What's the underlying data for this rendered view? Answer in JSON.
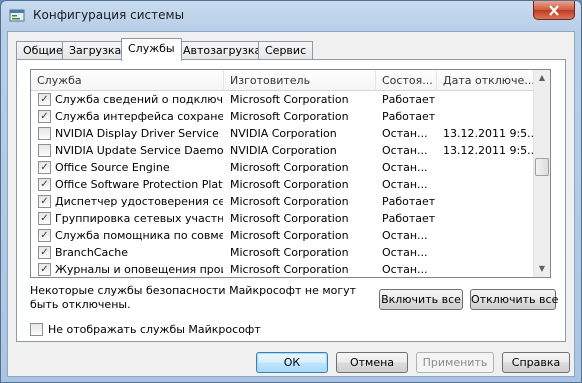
{
  "window": {
    "title": "Конфигурация системы"
  },
  "tabs": [
    "Общие",
    "Загрузка",
    "Службы",
    "Автозагрузка",
    "Сервис"
  ],
  "active_tab": "Службы",
  "table": {
    "headers": [
      "Служба",
      "Изготовитель",
      "Состоя...",
      "Дата отключе..."
    ],
    "rows": [
      {
        "checked": true,
        "name": "Служба сведений о подключе...",
        "maker": "Microsoft Corporation",
        "state": "Работает",
        "date": ""
      },
      {
        "checked": true,
        "name": "Служба интерфейса сохранен...",
        "maker": "Microsoft Corporation",
        "state": "Работает",
        "date": ""
      },
      {
        "checked": false,
        "name": "NVIDIA Display Driver Service",
        "maker": "NVIDIA Corporation",
        "state": "Остан...",
        "date": "13.12.2011 9:5..."
      },
      {
        "checked": false,
        "name": "NVIDIA Update Service Daemon",
        "maker": "NVIDIA Corporation",
        "state": "Остан...",
        "date": "13.12.2011 9:5..."
      },
      {
        "checked": true,
        "name": "Office  Source Engine",
        "maker": "Microsoft Corporation",
        "state": "Остан...",
        "date": ""
      },
      {
        "checked": true,
        "name": "Office Software Protection Platf...",
        "maker": "Microsoft Corporation",
        "state": "Остан...",
        "date": ""
      },
      {
        "checked": true,
        "name": "Диспетчер удостоверения сет...",
        "maker": "Microsoft Corporation",
        "state": "Работает",
        "date": ""
      },
      {
        "checked": true,
        "name": "Группировка сетевых участни...",
        "maker": "Microsoft Corporation",
        "state": "Работает",
        "date": ""
      },
      {
        "checked": true,
        "name": "Служба помощника по совмес...",
        "maker": "Microsoft Corporation",
        "state": "Остан...",
        "date": ""
      },
      {
        "checked": true,
        "name": "BranchCache",
        "maker": "Microsoft Corporation",
        "state": "Остан...",
        "date": ""
      },
      {
        "checked": true,
        "name": "Журналы и оповещения произ...",
        "maker": "Microsoft Corporation",
        "state": "Остан...",
        "date": ""
      }
    ]
  },
  "note": "Некоторые службы безопасности Майкрософт не могут быть отключены.",
  "enable_all": "Включить все",
  "disable_all": "Отключить все",
  "hide_ms": {
    "label": "Не отображать службы Майкрософт",
    "checked": false
  },
  "footer": {
    "ok": "ОК",
    "cancel": "Отмена",
    "apply": "Применить",
    "help": "Справка"
  },
  "check_mark": "✓",
  "icons": {
    "close": "close-icon",
    "scroll_up": "scroll-up-icon",
    "scroll_down": "scroll-down-icon",
    "app": "msconfig-icon"
  }
}
